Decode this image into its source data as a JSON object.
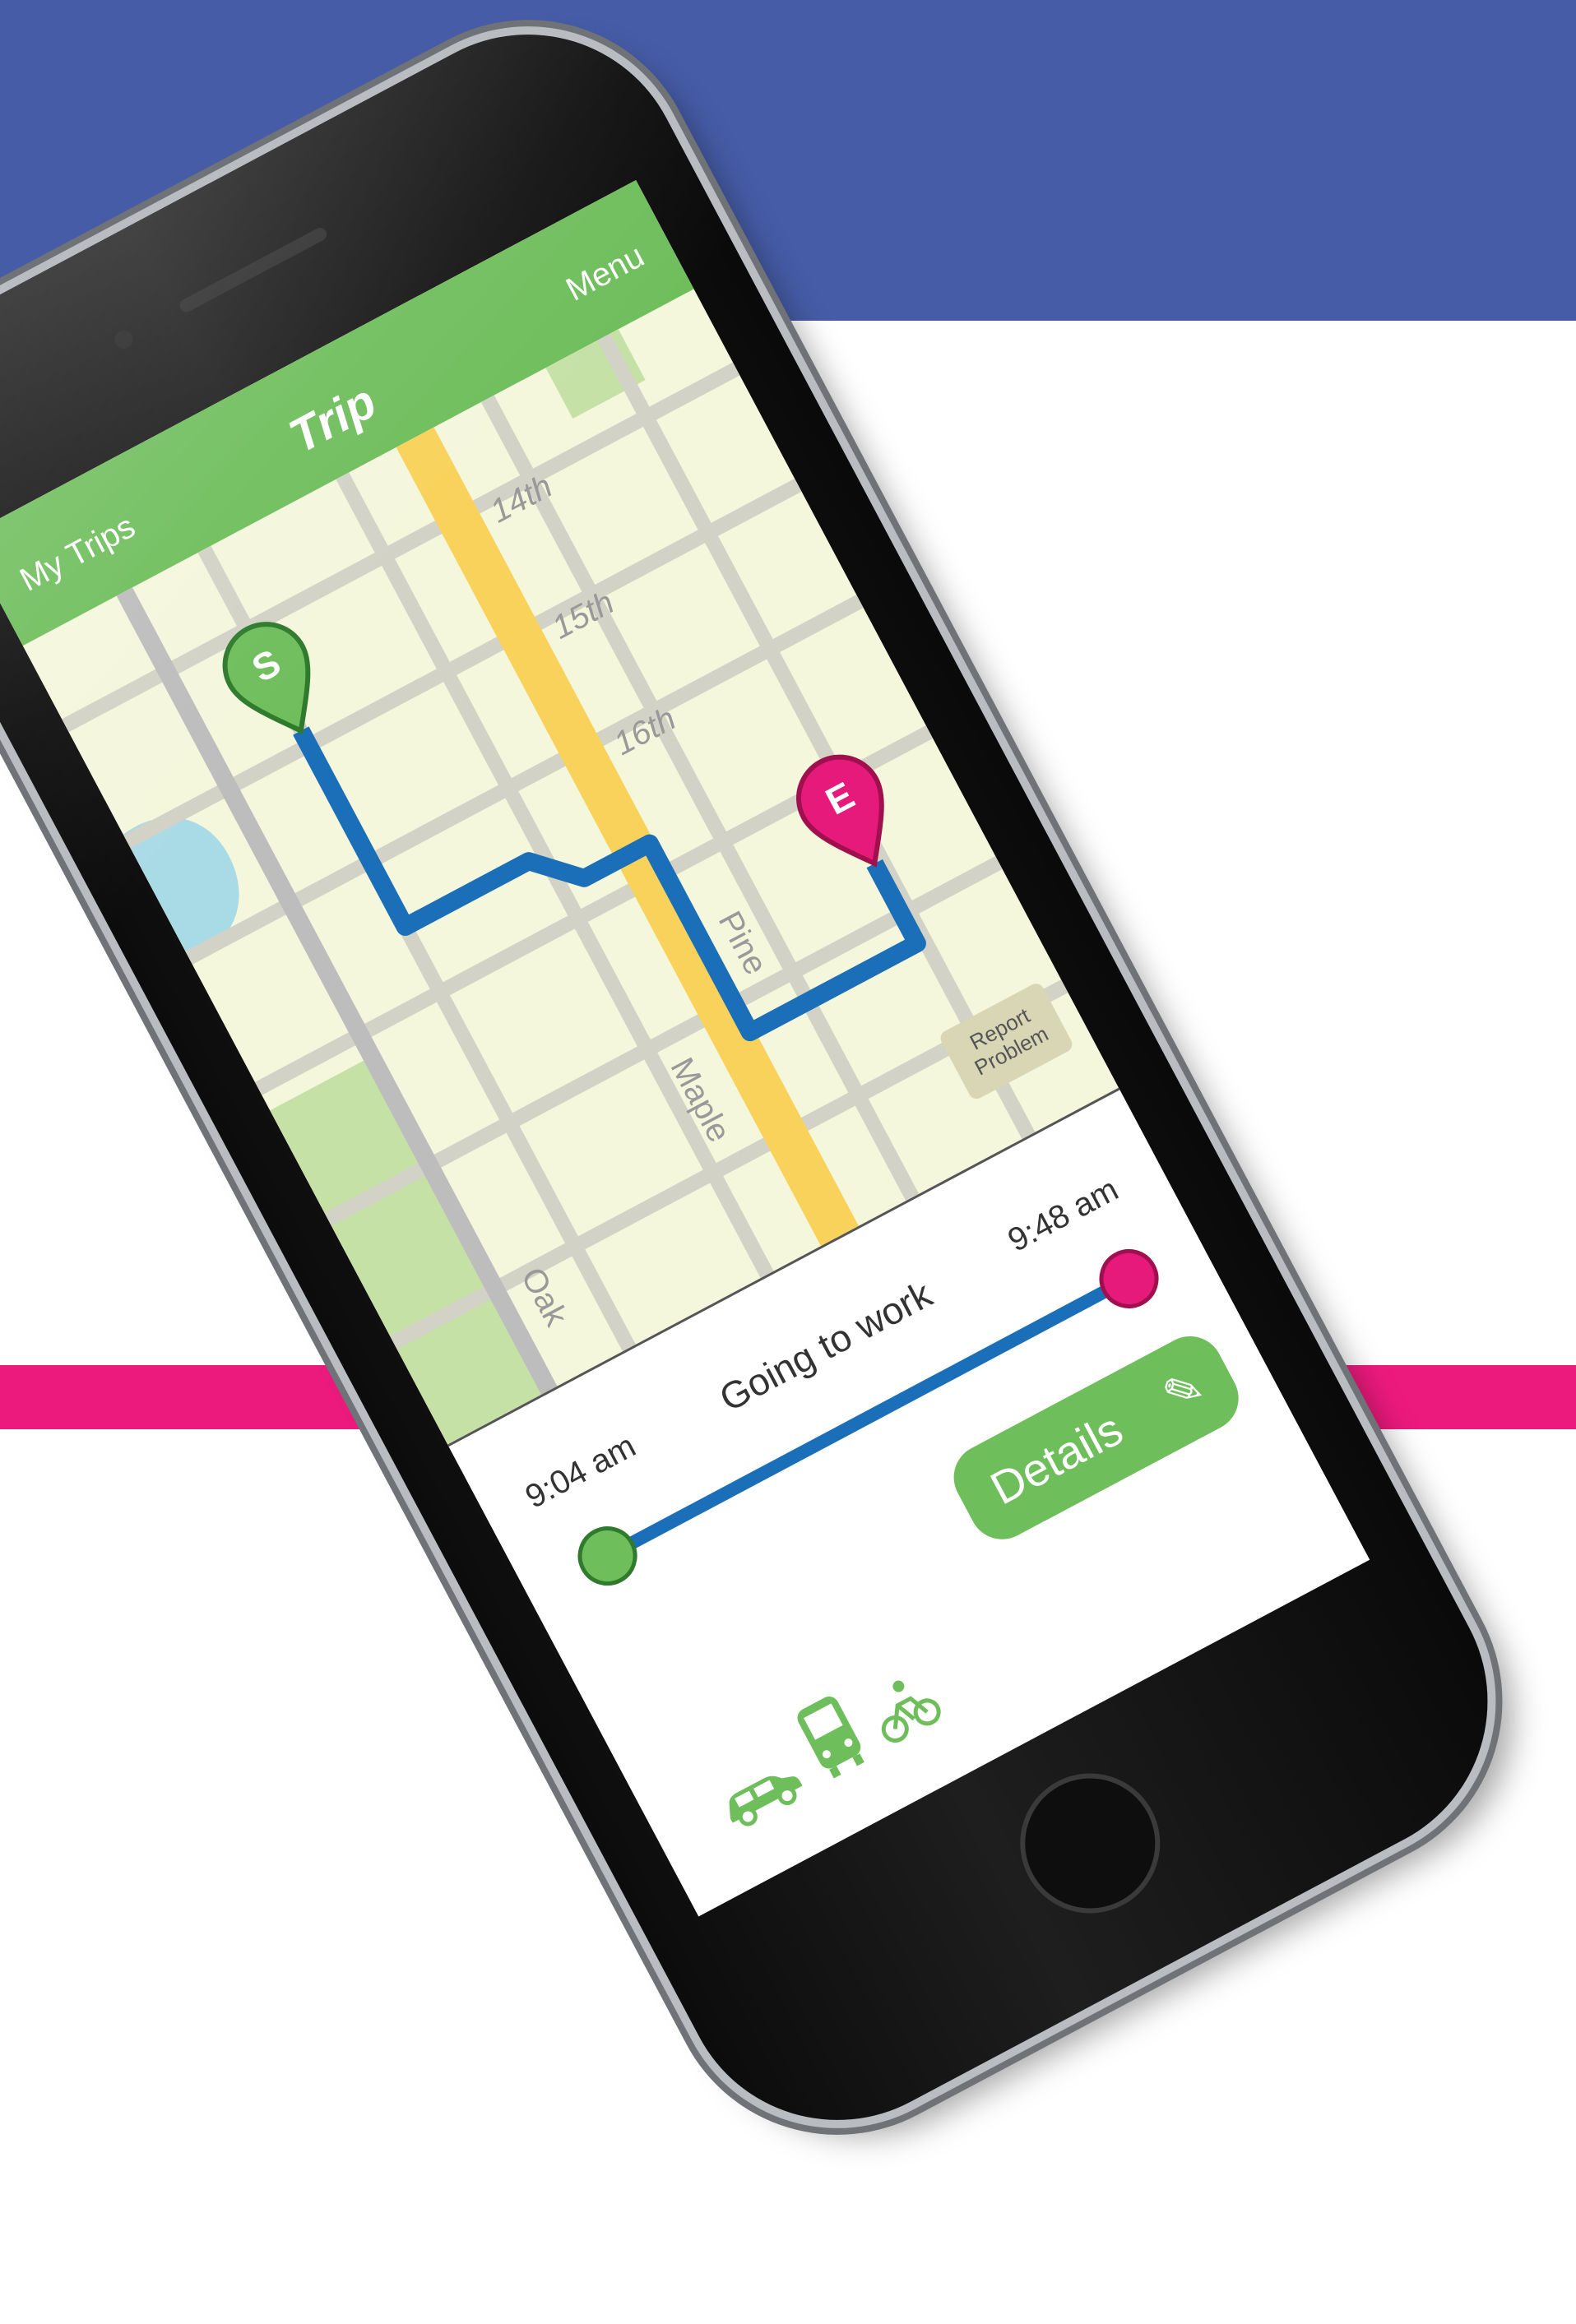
{
  "header": {
    "title": "Trip",
    "left_link": "My Trips",
    "right_link": "Menu"
  },
  "map": {
    "streets": {
      "numbered": [
        "14th",
        "15th",
        "16th"
      ],
      "named": [
        "Pine",
        "Maple",
        "Oak"
      ]
    },
    "start_marker": "S",
    "end_marker": "E",
    "report_button": [
      "Report",
      "Problem"
    ]
  },
  "trip": {
    "name": "Going to work",
    "start_time": "9:04 am",
    "end_time": "9:48 am",
    "details_label": "Details"
  },
  "modes": {
    "icons": [
      "car-icon",
      "bus-icon",
      "bicycle-icon"
    ]
  },
  "colors": {
    "top_band": "#465ca7",
    "pink_band": "#ec1a7d",
    "header_green": "#6fbe5c",
    "route_blue": "#1b6fb8",
    "highway_yellow": "#f8d25a",
    "start_green": "#6fbe5c",
    "end_pink": "#e51a7b",
    "map_bg": "#f4f7dc"
  }
}
